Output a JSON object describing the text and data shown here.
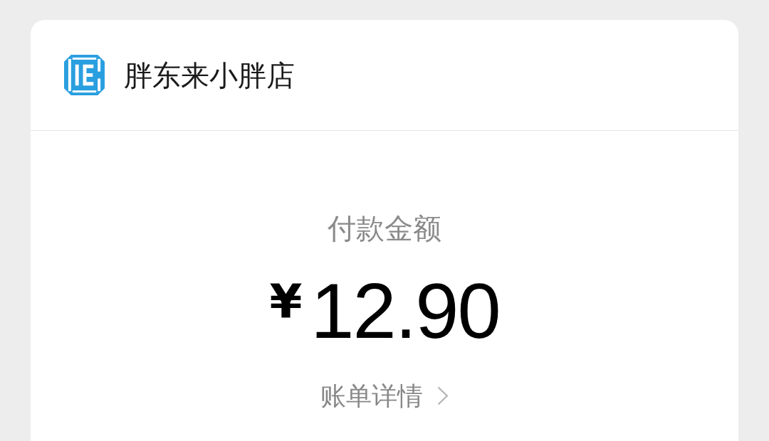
{
  "merchant": {
    "name": "胖东来小胖店"
  },
  "payment": {
    "label": "付款金额",
    "currency": "¥",
    "amount": "12.90"
  },
  "details_link": {
    "label": "账单详情"
  }
}
